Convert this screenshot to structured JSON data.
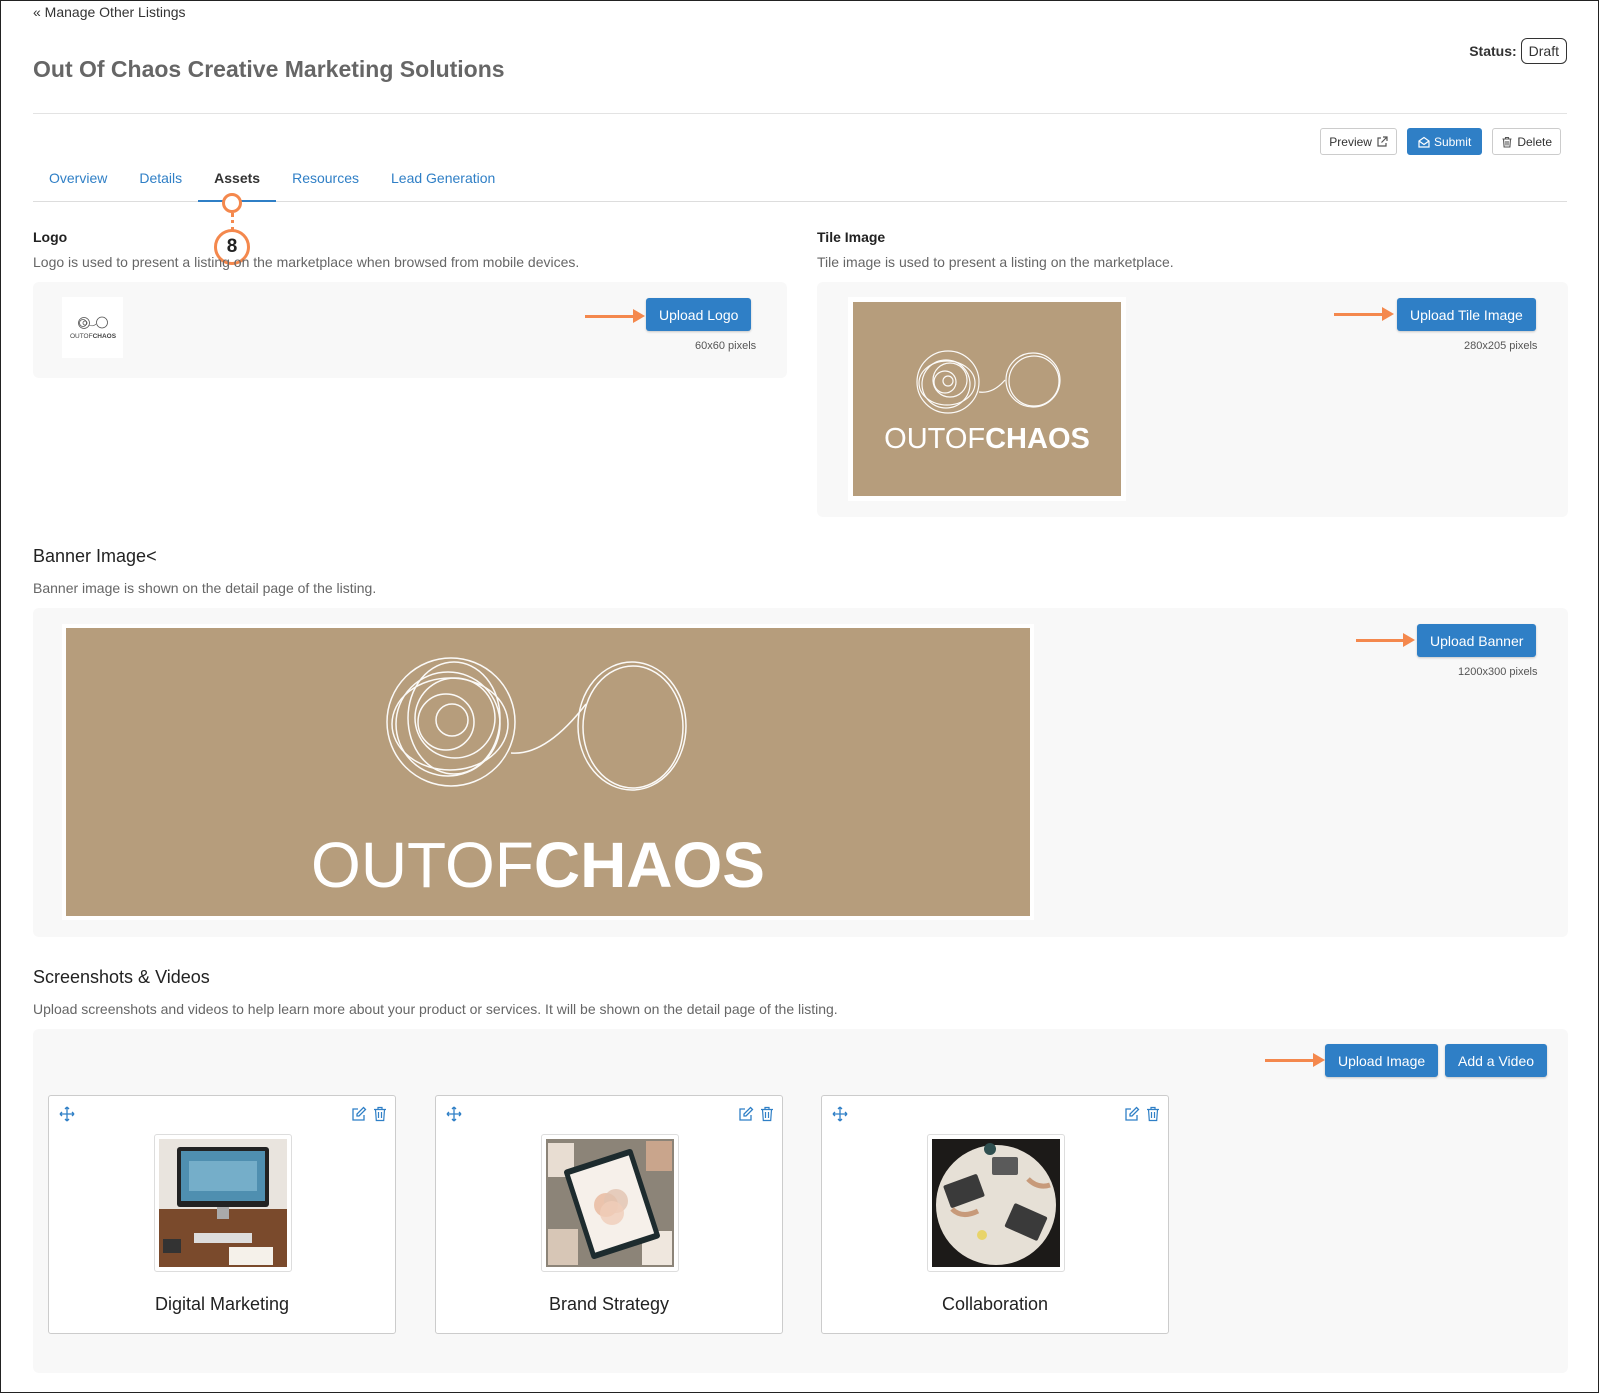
{
  "nav": {
    "back_link": "« Manage Other Listings"
  },
  "header": {
    "title": "Out Of Chaos Creative Marketing Solutions",
    "status_label": "Status:",
    "status_value": "Draft"
  },
  "actions": {
    "preview": "Preview",
    "submit": "Submit",
    "delete": "Delete"
  },
  "tabs": [
    {
      "label": "Overview"
    },
    {
      "label": "Details"
    },
    {
      "label": "Assets",
      "active": true
    },
    {
      "label": "Resources"
    },
    {
      "label": "Lead Generation"
    }
  ],
  "step_marker": "8",
  "logo": {
    "label": "Logo",
    "description": "Logo is used to present a listing on the marketplace when browsed from mobile devices.",
    "button": "Upload Logo",
    "dimensions": "60x60 pixels",
    "brand_light": "OUTOF",
    "brand_bold": "CHAOS"
  },
  "tile": {
    "label": "Tile Image",
    "description": "Tile image is used to present a listing on the marketplace.",
    "button": "Upload Tile Image",
    "dimensions": "280x205 pixels",
    "brand_light": "OUTOF",
    "brand_bold": "CHAOS"
  },
  "banner": {
    "label": "Banner Image<",
    "description": "Banner image is shown on the detail page of the listing.",
    "button": "Upload Banner",
    "dimensions": "1200x300 pixels",
    "brand_light": "OUTOF",
    "brand_bold": "CHAOS"
  },
  "media": {
    "label": "Screenshots & Videos",
    "description": "Upload screenshots and videos to help learn more about your product or services. It will be shown on the detail page of the listing.",
    "upload_image": "Upload Image",
    "add_video": "Add a Video",
    "items": [
      {
        "caption": "Digital Marketing"
      },
      {
        "caption": "Brand Strategy"
      },
      {
        "caption": "Collaboration"
      }
    ]
  },
  "colors": {
    "accent": "#2f7fc6",
    "annotation": "#f4884d",
    "brand_tan": "#b69d7c"
  }
}
